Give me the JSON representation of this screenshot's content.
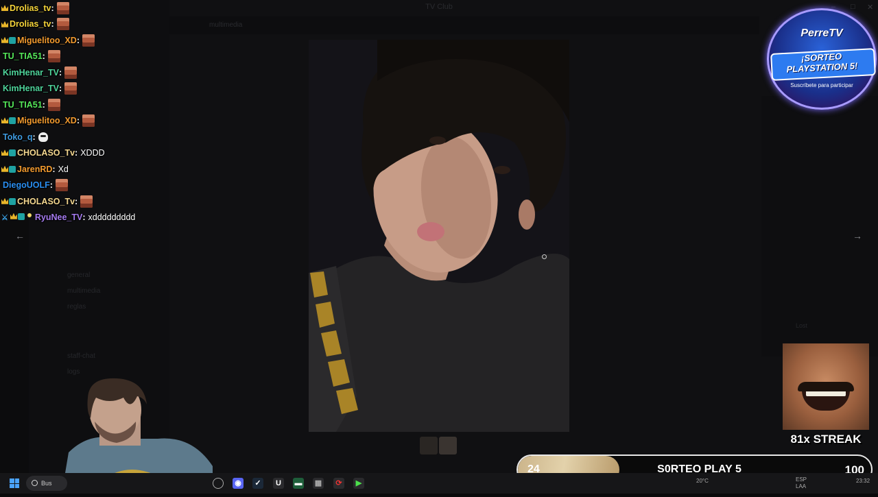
{
  "background_app": {
    "window_title": "TV Club",
    "channel_header": "multimedia",
    "channels": [
      "general",
      "multimedia",
      "reglas",
      "staff-chat",
      "logs"
    ],
    "members_heading": "Lost"
  },
  "viewer": {
    "prev_label": "←",
    "next_label": "→"
  },
  "chat": [
    {
      "user": "Drolias_tv",
      "color": "#f5d43a",
      "badges": [
        "crown"
      ],
      "text": "",
      "emote": "face"
    },
    {
      "user": "Drolias_tv",
      "color": "#f5d43a",
      "badges": [
        "crown"
      ],
      "text": "",
      "emote": "face"
    },
    {
      "user": "Miguelitoo_XD",
      "color": "#f29a2e",
      "badges": [
        "crown",
        "sub"
      ],
      "text": "",
      "emote": "face"
    },
    {
      "user": "TU_TIA51",
      "color": "#55e85a",
      "badges": [],
      "text": "",
      "emote": "face"
    },
    {
      "user": "KimHenar_TV",
      "color": "#4fd49b",
      "badges": [],
      "text": "",
      "emote": "face"
    },
    {
      "user": "KimHenar_TV",
      "color": "#4fd49b",
      "badges": [],
      "text": "",
      "emote": "face"
    },
    {
      "user": "TU_TIA51",
      "color": "#55e85a",
      "badges": [],
      "text": "",
      "emote": "face"
    },
    {
      "user": "Miguelitoo_XD",
      "color": "#f29a2e",
      "badges": [
        "crown",
        "sub"
      ],
      "text": "",
      "emote": "face"
    },
    {
      "user": "Toko_q",
      "color": "#3f9be0",
      "badges": [],
      "text": "",
      "emote": "ghost"
    },
    {
      "user": "CHOLASO_Tv",
      "color": "#f5d890",
      "badges": [
        "crown",
        "sub"
      ],
      "text": "XDDD",
      "emote": ""
    },
    {
      "user": "JarenRD",
      "color": "#f29a2e",
      "badges": [
        "crown",
        "sub"
      ],
      "text": "Xd",
      "emote": ""
    },
    {
      "user": "DiegoUOLF",
      "color": "#2a8ef0",
      "badges": [],
      "text": "",
      "emote": "face"
    },
    {
      "user": "CHOLASO_Tv",
      "color": "#f5d890",
      "badges": [
        "crown",
        "sub"
      ],
      "text": "",
      "emote": "face"
    },
    {
      "user": "RyuNee_TV",
      "color": "#a57bf0",
      "badges": [
        "sword",
        "crown",
        "sub",
        "dot"
      ],
      "text": "xddddddddd",
      "emote": ""
    }
  ],
  "promo": {
    "brand": "PerreTV",
    "title_line1": "¡SORTEO",
    "title_line2": "PLAYSTATION 5!",
    "subtitle": "Suscríbete para participar"
  },
  "streak": {
    "label": "81x STREAK"
  },
  "goal": {
    "current": "24",
    "title": "S0RTEO PLAY 5",
    "target": "100",
    "progress_percent": 24
  },
  "taskbar": {
    "search_placeholder": "Bus",
    "tray_lang": "ESP",
    "tray_lang2": "LAA",
    "weather": "20°C",
    "clock": "23:32"
  }
}
